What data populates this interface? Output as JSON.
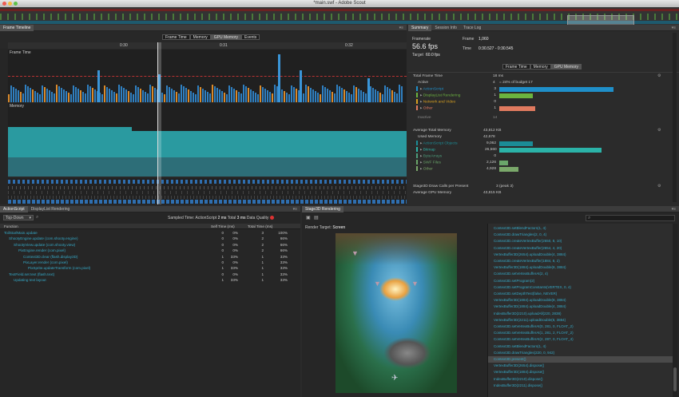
{
  "window": {
    "title": "*main.swf - Adobe Scout"
  },
  "frame_timeline": {
    "tab": "Frame Timeline",
    "modes": [
      "Frame Time",
      "Memory",
      "GPU Memory",
      "Events"
    ],
    "active_mode": "GPU Memory",
    "times": [
      "0:30",
      "0:31",
      "0:32"
    ],
    "graph1_label": "Frame Time",
    "graph2_label": "Memory"
  },
  "summary": {
    "tabs": [
      "Summary",
      "Session Info",
      "Trace Log"
    ],
    "framerate_label": "Framerate",
    "framerate_value": "56.6 fps",
    "target_label": "Target",
    "target_value": "60.0 fps",
    "frame_label": "Frame",
    "frame_value": "1,060",
    "time_label": "Time",
    "time_value": "0:30.527 - 0:30.545",
    "modes": [
      "Frame Time",
      "Memory",
      "GPU Memory"
    ],
    "total_frame_time_label": "Total Frame Time",
    "total_frame_time_value": "18 ms",
    "active_label": "Active",
    "active_value": "4",
    "active_note": "= 24% of budget 17",
    "frame_rows": [
      {
        "name": "ActionScript",
        "value": "3",
        "color": "#1f8fc9",
        "frac": 0.95
      },
      {
        "name": "DisplayList Rendering",
        "value": "1",
        "color": "#6cb33f",
        "frac": 0.28
      },
      {
        "name": "Network and Video",
        "value": "0",
        "color": "#d8a020",
        "frac": 0
      },
      {
        "name": "Other",
        "value": "1",
        "color": "#e07a5f",
        "frac": 0.3
      }
    ],
    "inactive_label": "Inactive",
    "inactive_value": "14",
    "avg_memory_label": "Average Total Memory",
    "avg_memory_value": "43,812 KB",
    "used_memory_label": "Used Memory",
    "used_memory_value": "42,678",
    "memory_rows": [
      {
        "name": "ActionScript Objects",
        "value": "9,062",
        "color": "#1b8c96",
        "frac": 0.28
      },
      {
        "name": "Bitmap",
        "value": "26,560",
        "color": "#2bb3a8",
        "frac": 0.85
      },
      {
        "name": "ByteArrays",
        "value": "0",
        "color": "#4c9b7a",
        "frac": 0
      },
      {
        "name": "SWF Files",
        "value": "2,126",
        "color": "#6aa66a",
        "frac": 0.07
      },
      {
        "name": "Other",
        "value": "4,928",
        "color": "#7aa86a",
        "frac": 0.16
      }
    ],
    "draw_calls_label": "Stage3D Draw Calls per Present",
    "draw_calls_value": "3 (peak 3)",
    "gpu_memory_label": "Average GPU Memory",
    "gpu_memory_value": "43,815 KB"
  },
  "actionscript_panel": {
    "tabs": [
      "ActionScript",
      "DisplayList Rendering"
    ],
    "view_select": "Top-Down",
    "sampled_label": "Sampled Time:",
    "sampled_scope": "ActionScript",
    "sampled_value": "2 ms",
    "total_label": "Total",
    "total_value": "3 ms",
    "quality_label": "Data Quality",
    "columns": [
      "Function",
      "Self Time (ms)",
      "Total Time (ms)"
    ],
    "rows": [
      {
        "name": "ToilStarlMain.update",
        "self": "0",
        "self_pct": "0%",
        "total": "3",
        "total_pct": "100%",
        "indent": 0
      },
      {
        "name": "ShootyEngine.update (com.shooty.engine)",
        "self": "0",
        "self_pct": "0%",
        "total": "2",
        "total_pct": "66%",
        "indent": 1
      },
      {
        "name": "ShootyView.update (com.shooty.view)",
        "self": "0",
        "self_pct": "0%",
        "total": "2",
        "total_pct": "66%",
        "indent": 2
      },
      {
        "name": "PixEngine.render (com.pixel)",
        "self": "0",
        "self_pct": "0%",
        "total": "2",
        "total_pct": "66%",
        "indent": 3
      },
      {
        "name": "Context3D.clear (flash.display3D)",
        "self": "1",
        "self_pct": "33%",
        "total": "1",
        "total_pct": "33%",
        "indent": 4
      },
      {
        "name": "PixLayer.render (com.pixel)",
        "self": "0",
        "self_pct": "0%",
        "total": "1",
        "total_pct": "33%",
        "indent": 4
      },
      {
        "name": "PixSprite.updateTransform (com.pixel)",
        "self": "1",
        "self_pct": "33%",
        "total": "1",
        "total_pct": "33%",
        "indent": 5
      },
      {
        "name": "TextField.set text (flash.text)",
        "self": "0",
        "self_pct": "0%",
        "total": "1",
        "total_pct": "33%",
        "indent": 1
      },
      {
        "name": "Updating text layout",
        "self": "1",
        "self_pct": "33%",
        "total": "1",
        "total_pct": "33%",
        "indent": 2
      }
    ]
  },
  "stage3d_panel": {
    "tab": "Stage3D Rendering",
    "render_target_label": "Render Target:",
    "render_target_value": "Screen",
    "calls": [
      "Context3D.setBlendFactors(1, 4)",
      "Context3D.drawTriangles(2, 0, 4)",
      "Context3D.createVertexBuffer(2650, 8, 10)",
      "Context3D.createVertexBuffer(2654, 4, 20)",
      "VertexBuffer3D(2654).uploadDouble(4, 3884)",
      "Context3D.createVertexBuffer(1884, 8, 2)",
      "VertexBuffer3D(1884).uploadDouble(8, 3884)",
      "Context3D.setVertexBufferAt(2, 4)",
      "Context3D.setProgram(2)",
      "Context3D.setProgramConstants(VERTEX, 0, 4)",
      "Context3D.setDepthTest(false, NEVER)",
      "VertexBuffer3D(1884).uploadDouble(8, 3884)",
      "VertexBuffer3D(1884).uploadDouble(4, 3884)",
      "IndexBuffer3D(2210).uploadAll(220, 2838)",
      "VertexBuffer3D(2211).uploadDouble(8, 3884)",
      "Context3D.setVertexBufferAt(0, 281, 0, FLOAT_2)",
      "Context3D.setVertexBufferAt(1, 281, 2, FLOAT_2)",
      "Context3D.setVertexBufferAt(2, 287, 0, FLOAT_4)",
      "Context3D.setBlendFactors(1, 4)",
      "Context3D.drawTriangles(220, 0, 942)",
      "Context3D.present()",
      "VertexBuffer3D(2654).dispose()",
      "VertexBuffer3D(1884).dispose()",
      "IndexBuffer3D(2210).dispose()",
      "IndexBuffer3D(2211).dispose()"
    ],
    "selected_index": 20
  }
}
